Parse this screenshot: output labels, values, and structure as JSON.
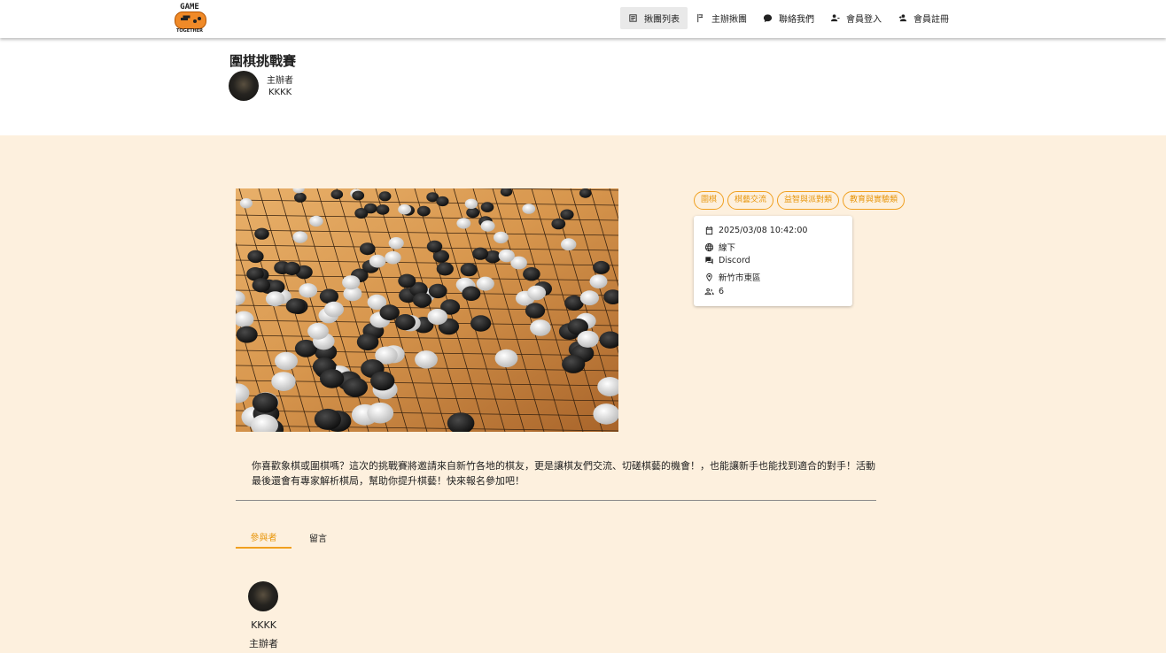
{
  "logo": {
    "top_text": "GAME",
    "bottom_text": "TOGETHER"
  },
  "nav": {
    "items": [
      {
        "label": "揪團列表",
        "icon": "list-icon",
        "active": true
      },
      {
        "label": "主辦揪團",
        "icon": "flag-icon"
      },
      {
        "label": "聯絡我們",
        "icon": "chat-bubble-icon"
      },
      {
        "label": "會員登入",
        "icon": "login-user-icon"
      },
      {
        "label": "會員註冊",
        "icon": "register-user-icon"
      }
    ]
  },
  "event": {
    "title": "圍棋挑戰賽",
    "organizer_role": "主辦者",
    "organizer_name": "KKKK",
    "photo": "go-board-photo",
    "tags": [
      "圍棋",
      "棋藝交流",
      "益智與派對類",
      "教育與實驗類"
    ],
    "info": {
      "datetime": "2025/03/08 10:42:00",
      "mode": "線下",
      "platform": "Discord",
      "location": "新竹市東區",
      "participants": "6"
    },
    "description": "你喜歡象棋或圍棋嗎？這次的挑戰賽將邀請來自新竹各地的棋友，更是讓棋友們交流、切磋棋藝的機會！，也能讓新手也能找到適合的對手！活動最後還會有專家解析棋局，幫助你提升棋藝！快來報名參加吧！"
  },
  "tabs": [
    {
      "label": "參與者",
      "active": true
    },
    {
      "label": "留言"
    }
  ],
  "participants": [
    {
      "name": "KKKK",
      "role": "主辦者"
    }
  ],
  "colors": {
    "accent": "#f0a020",
    "background": "#fdf0de"
  }
}
